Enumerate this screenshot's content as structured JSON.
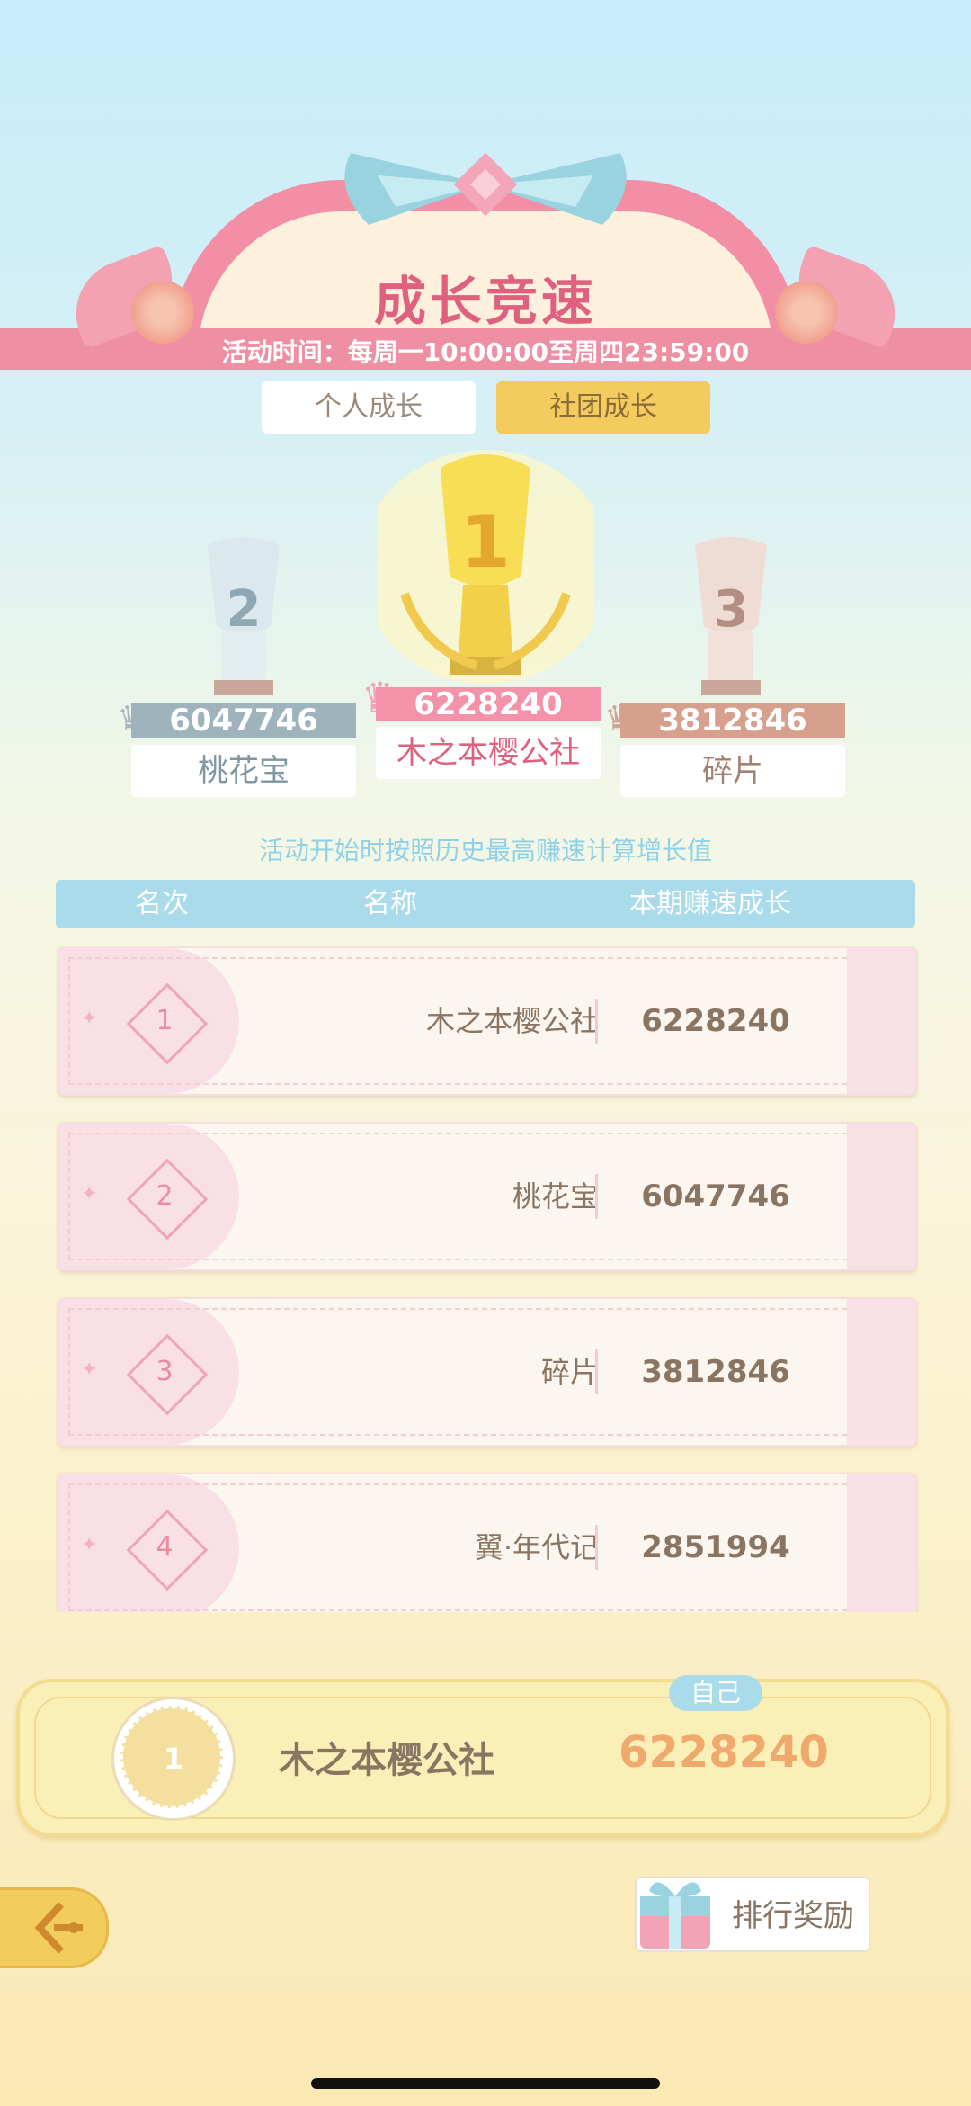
{
  "header": {
    "title": "成长竞速",
    "event_time": "活动时间：每周一10:00:00至周四23:59:00"
  },
  "tabs": [
    {
      "label": "个人成长",
      "active": false
    },
    {
      "label": "社团成长",
      "active": true
    }
  ],
  "podium": {
    "first": {
      "rank": "1",
      "value": "6228240",
      "name": "木之本樱公社"
    },
    "second": {
      "rank": "2",
      "value": "6047746",
      "name": "桃花宝"
    },
    "third": {
      "rank": "3",
      "value": "3812846",
      "name": "碎片"
    }
  },
  "note": "活动开始时按照历史最高赚速计算增长值",
  "table": {
    "headers": [
      "名次",
      "名称",
      "本期赚速成长"
    ],
    "rows": [
      {
        "rank": "1",
        "name": "木之本樱公社",
        "value": "6228240"
      },
      {
        "rank": "2",
        "name": "桃花宝",
        "value": "6047746"
      },
      {
        "rank": "3",
        "name": "碎片",
        "value": "3812846"
      },
      {
        "rank": "4",
        "name": "翼·年代记",
        "value": "2851994"
      }
    ]
  },
  "self": {
    "tag": "自己",
    "rank": "1",
    "name": "木之本樱公社",
    "value": "6228240"
  },
  "reward_button": "排行奖励",
  "colors": {
    "pink_accent": "#e0607f",
    "ribbon": "#ef8fa3",
    "header_blue": "#a9dbea",
    "gold": "#f4cb5e",
    "value_orange": "#f0a96d"
  },
  "icons": [
    "rose-icon",
    "bow-icon",
    "crown-icon",
    "trophy-icon",
    "gift-icon",
    "back-icon"
  ]
}
